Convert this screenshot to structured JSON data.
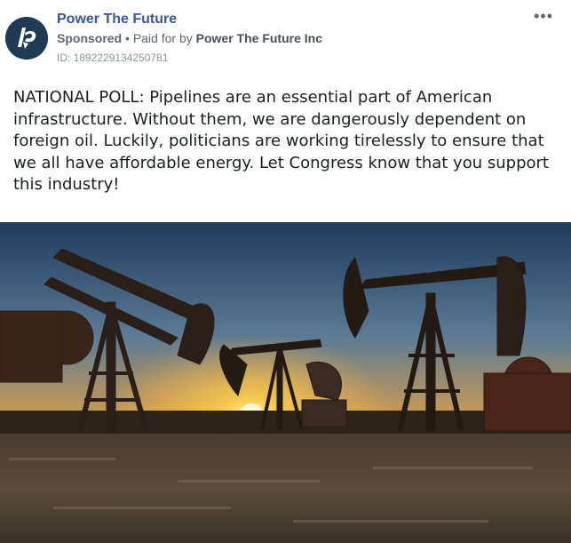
{
  "post": {
    "page_name": "Power The Future",
    "sponsored_label": "Sponsored",
    "separator": " • ",
    "paid_for_prefix": "Paid for by ",
    "payer": "Power The Future Inc",
    "ad_id": "ID: 1892229134250781",
    "more_icon": "•••",
    "body_text": "NATIONAL POLL: Pipelines are an essential part of American infrastructure. Without them, we are dangerously dependent on foreign oil. Luckily, politicians are working tirelessly to ensure that we all have affordable energy. Let Congress know that you support this industry!"
  },
  "icons": {
    "avatar": "power-the-future-logo",
    "more": "more-options-icon"
  },
  "colors": {
    "link_blue": "#385898",
    "meta_gray": "#616770",
    "avatar_bg": "#1f3b55"
  }
}
